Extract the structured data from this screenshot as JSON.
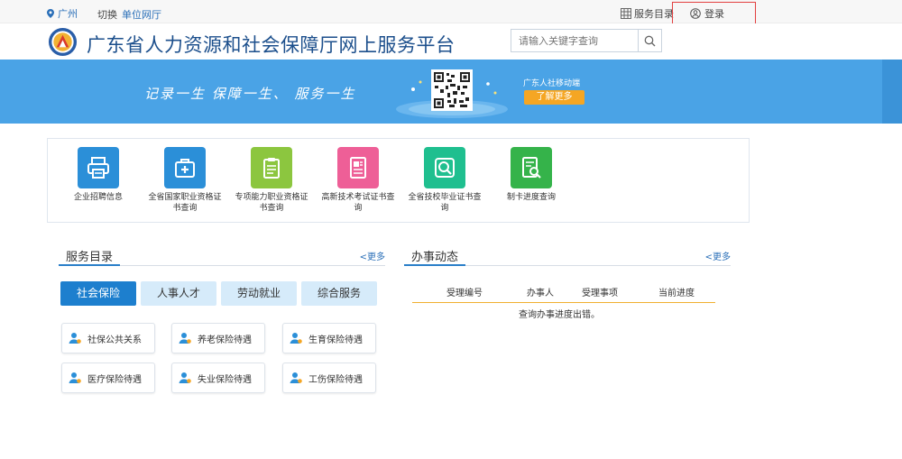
{
  "topbar": {
    "city": "广州",
    "switch_label": "切换",
    "unit_label": "单位网厅",
    "service_dir": "服务目录",
    "login": "登录"
  },
  "header": {
    "title": "广东省人力资源和社会保障厅网上服务平台",
    "search_placeholder": "请输入关键字查询"
  },
  "banner": {
    "slogan": "记录一生   保障一生、   服务一生",
    "mobile_text": "广东人社移动端",
    "learn_more": "了解更多",
    "bg_color": "#4aa3e6"
  },
  "quick_links": [
    {
      "label": "企业招聘信息",
      "color": "#2b8fd8",
      "icon": "printer-icon"
    },
    {
      "label": "全省国家职业资格证书查询",
      "color": "#2b8fd8",
      "icon": "medical-kit-icon"
    },
    {
      "label": "专项能力职业资格证书查询",
      "color": "#8cc63f",
      "icon": "clipboard-icon"
    },
    {
      "label": "高新技术考试证书查询",
      "color": "#ee5f97",
      "icon": "id-card-icon"
    },
    {
      "label": "全省技校毕业证书查询",
      "color": "#1fbf8f",
      "icon": "magnifier-icon"
    },
    {
      "label": "制卡进度查询",
      "color": "#35b34a",
      "icon": "document-search-icon"
    }
  ],
  "service_catalog": {
    "title": "服务目录",
    "more": "<更多",
    "tabs": [
      "社会保险",
      "人事人才",
      "劳动就业",
      "综合服务"
    ],
    "items": [
      "社保公共关系",
      "养老保险待遇",
      "生育保险待遇",
      "医疗保险待遇",
      "失业保险待遇",
      "工伤保险待遇"
    ]
  },
  "affairs": {
    "title": "办事动态",
    "more": "<更多",
    "columns": [
      "受理编号",
      "办事人",
      "受理事项",
      "当前进度"
    ],
    "message": "查询办事进度出错。"
  }
}
